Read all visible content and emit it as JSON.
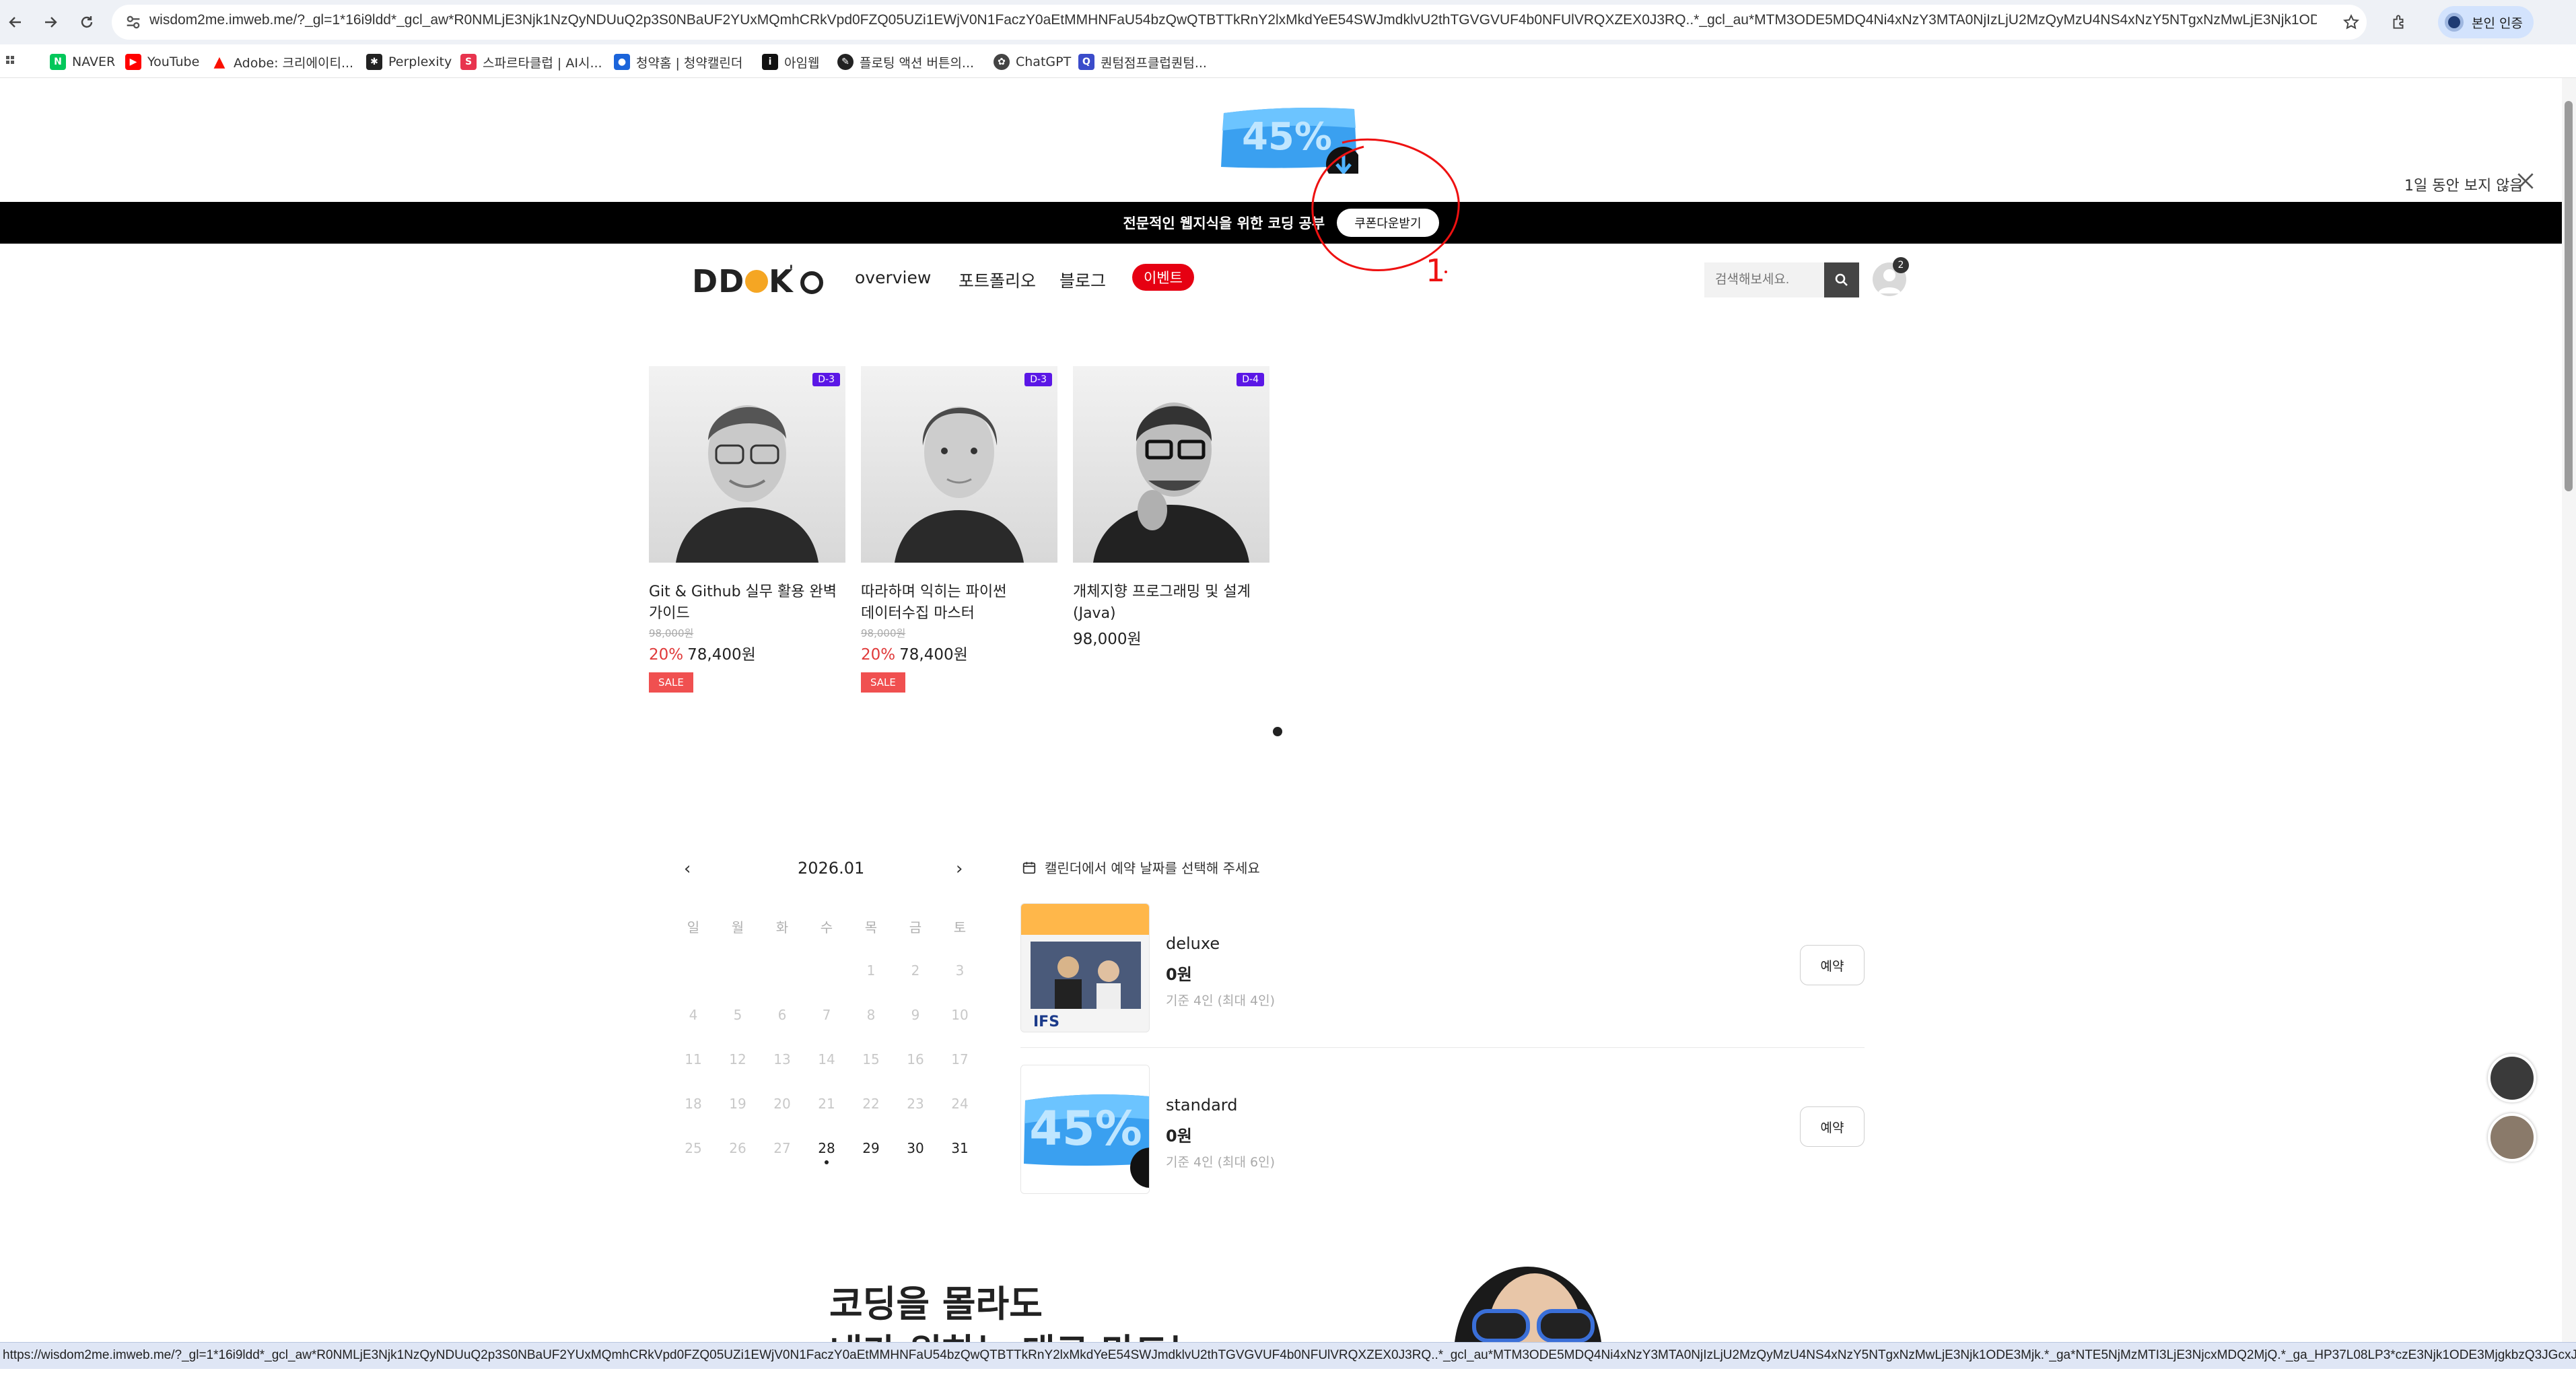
{
  "browser": {
    "url": "wisdom2me.imweb.me/?_gl=1*16i9ldd*_gcl_aw*R0NMLjE3Njk1NzQyNDUuQ2p3S0NBaUF2YUxMQmhCRkVpd0FZQ05UZi1EWjV0N1FaczY0aEtMMHNFaU54bzQwQTBTTkRnY2lxMkdYeE54SWJmdklvU2thTGVGVUF4b0NFUlVRQXZEX0J3RQ..*_gcl_au*MTM3ODE5MDQ4Ni4xNzY3MTA0NjIzLjU2MzQyMzU4NS4xNzY5NTgxNzMwLjE3Njk1ODE3Mjk.*...",
    "profile_label": "본인 인증",
    "status_url": "https://wisdom2me.imweb.me/?_gl=1*16i9ldd*_gcl_aw*R0NMLjE3Njk1NzQyNDUuQ2p3S0NBaUF2YUxMQmhCRkVpd0FZQ05UZi1EWjV0N1FaczY0aEtMMHNFaU54bzQwQTBTTkRnY2lxMkdYeE54SWJmdklvU2thTGVGVUF4b0NFUlVRQXZEX0J3RQ..*_gcl_au*MTM3ODE5MDQ4Ni4xNzY3MTA0NjIzLjU2MzQyMzU4NS4xNzY5NTgxNzMwLjE3Njk1ODE3Mjk.*_ga*NTE5NjMzMTI3LjE3NjcxMDQ2MjQ.*_ga_HP37L08LP3*czE3Njk1ODE3MjgkbzQ3JGcxJHQxNzY5NTgyMDI3JGo1MiR...",
    "bookmarks": [
      {
        "label": "NAVER",
        "icon": "naver-icon",
        "color": "#03c75a"
      },
      {
        "label": "YouTube",
        "icon": "youtube-icon",
        "color": "#ff0000"
      },
      {
        "label": "Adobe: 크리에이티...",
        "icon": "adobe-icon",
        "color": "#fa0f00"
      },
      {
        "label": "Perplexity",
        "icon": "perplexity-icon",
        "color": "#222222"
      },
      {
        "label": "스파르타클럽 | AI시...",
        "icon": "sparta-icon",
        "color": "#e8344e"
      },
      {
        "label": "청약홈 | 청약캘린더",
        "icon": "applyhome-icon",
        "color": "#1b64da"
      },
      {
        "label": "아임웹",
        "icon": "imweb-icon",
        "color": "#111111"
      },
      {
        "label": "플로팅 액션 버튼의...",
        "icon": "floating-icon",
        "color": "#222222"
      },
      {
        "label": "ChatGPT",
        "icon": "chatgpt-icon",
        "color": "#444444"
      },
      {
        "label": "퀀텀점프클럽퀀텀...",
        "icon": "quantum-icon",
        "color": "#3b4cca"
      }
    ]
  },
  "promo": {
    "badge_text": "45%",
    "hide_label": "1일 동안 보지 않음"
  },
  "topbar": {
    "text": "전문적인 웹지식을 위한 코딩 공부",
    "coupon_label": "쿠폰다운받기"
  },
  "annotation": {
    "mark": "1"
  },
  "header": {
    "logo": "DDOK'O",
    "nav": [
      "overview",
      "포트폴리오",
      "블로그"
    ],
    "event_label": "이벤트",
    "search_placeholder": "검색해보세요.",
    "cart_count": "2"
  },
  "products": [
    {
      "badge": "D-3",
      "title_line1": "Git & Github 실무 활용 완벽",
      "title_line2": "가이드",
      "orig_price": "98,000원",
      "discount": "20%",
      "price": "78,400원",
      "sale_label": "SALE"
    },
    {
      "badge": "D-3",
      "title_line1": "따라하며 익히는 파이썬",
      "title_line2": "데이터수집 마스터",
      "orig_price": "98,000원",
      "discount": "20%",
      "price": "78,400원",
      "sale_label": "SALE"
    },
    {
      "badge": "D-4",
      "title_line1": "개체지향 프로그래밍 및 설계",
      "title_line2": "(Java)",
      "orig_price": "",
      "discount": "",
      "price": "98,000원",
      "sale_label": ""
    }
  ],
  "calendar": {
    "month": "2026.01",
    "weekdays": [
      "일",
      "월",
      "화",
      "수",
      "목",
      "금",
      "토"
    ],
    "weeks": [
      [
        "",
        "",
        "",
        "",
        "1",
        "2",
        "3"
      ],
      [
        "4",
        "5",
        "6",
        "7",
        "8",
        "9",
        "10"
      ],
      [
        "11",
        "12",
        "13",
        "14",
        "15",
        "16",
        "17"
      ],
      [
        "18",
        "19",
        "20",
        "21",
        "22",
        "23",
        "24"
      ],
      [
        "25",
        "26",
        "27",
        "28",
        "29",
        "30",
        "31"
      ]
    ],
    "active_days": [
      "28",
      "29",
      "30",
      "31"
    ],
    "today": "28"
  },
  "booking": {
    "hint": "캘린더에서 예약 날짜를 선택해 주세요",
    "rooms": [
      {
        "name": "deluxe",
        "price": "0원",
        "capacity": "기준 4인 (최대 4인)",
        "button": "예약",
        "thumb_text": "IFS"
      },
      {
        "name": "standard",
        "price": "0원",
        "capacity": "기준 4인 (최대 6인)",
        "button": "예약",
        "thumb_text": "45%"
      }
    ]
  },
  "section": {
    "headline_line1": "코딩을 몰라도",
    "headline_line2": "내가 원하는 대로 만드는"
  },
  "colors": {
    "accent_red": "#e60012",
    "badge_purple": "#5b17e6",
    "sale_red": "#f05050",
    "promo_blue": "#3aa0f0"
  }
}
